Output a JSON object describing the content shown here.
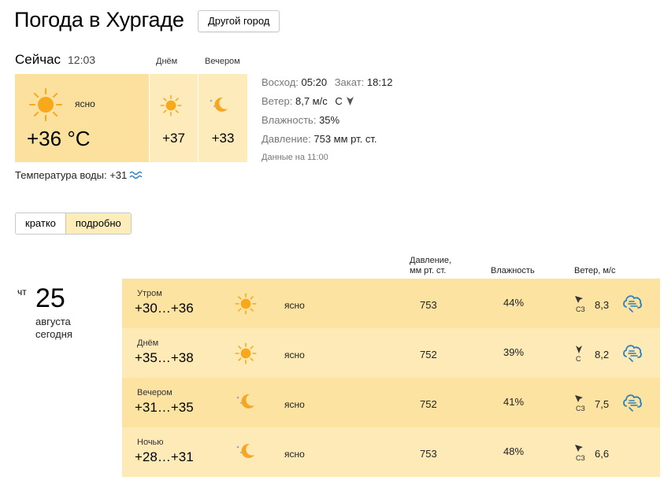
{
  "header": {
    "title": "Погода в Хургаде",
    "city_button": "Другой город"
  },
  "now": {
    "label": "Сейчас",
    "time": "12:03",
    "condition": "ясно",
    "temp": "+36 °C",
    "icon": "sun-icon"
  },
  "later": {
    "day_label": "Днём",
    "day_temp": "+37",
    "day_icon": "sun-icon",
    "evening_label": "Вечером",
    "evening_temp": "+33",
    "evening_icon": "moon-icon"
  },
  "details": {
    "sunrise_label": "Восход:",
    "sunrise": "05:20",
    "sunset_label": "Закат:",
    "sunset": "18:12",
    "wind_label": "Ветер:",
    "wind": "8,7 м/с",
    "wind_dir": "С",
    "humidity_label": "Влажность:",
    "humidity": "35%",
    "pressure_label": "Давление:",
    "pressure": "753 мм рт. ст.",
    "data_time": "Данные на 11:00"
  },
  "water": {
    "label": "Температура воды:",
    "value": "+31",
    "icon": "water-wave-icon"
  },
  "tabs": [
    {
      "label": "кратко",
      "active": false
    },
    {
      "label": "подробно",
      "active": true
    }
  ],
  "columns": {
    "pressure_line1": "Давление,",
    "pressure_line2": "мм рт. ст.",
    "humidity": "Влажность",
    "wind": "Ветер, м/с"
  },
  "forecast_day": {
    "dow": "чт",
    "day": "25",
    "month": "августа",
    "relative": "сегодня"
  },
  "periods": [
    {
      "name": "Утром",
      "range": "+30…+36",
      "icon": "sun-icon",
      "condition": "ясно",
      "pressure": "753",
      "humidity": "44%",
      "wind_dir": "СЗ",
      "wind_arrow": "arrow-northwest-icon",
      "wind": "8,3",
      "gust_icon": "strong-wind-icon"
    },
    {
      "name": "Днём",
      "range": "+35…+38",
      "icon": "sun-icon",
      "condition": "ясно",
      "pressure": "752",
      "humidity": "39%",
      "wind_dir": "С",
      "wind_arrow": "arrow-north-icon",
      "wind": "8,2",
      "gust_icon": "strong-wind-icon"
    },
    {
      "name": "Вечером",
      "range": "+31…+35",
      "icon": "moon-icon",
      "condition": "ясно",
      "pressure": "752",
      "humidity": "41%",
      "wind_dir": "СЗ",
      "wind_arrow": "arrow-northwest-icon",
      "wind": "7,5",
      "gust_icon": "strong-wind-icon"
    },
    {
      "name": "Ночью",
      "range": "+28…+31",
      "icon": "moon-icon",
      "condition": "ясно",
      "pressure": "753",
      "humidity": "48%",
      "wind_dir": "СЗ",
      "wind_arrow": "arrow-northwest-icon",
      "wind": "6,6",
      "gust_icon": ""
    }
  ],
  "colors": {
    "now_card": "#fbe19d",
    "later_card": "#fdebbb",
    "row_dark": "#fce3a2",
    "row_light": "#fdeab7",
    "sun": "#f7a81b",
    "moon": "#f5a623",
    "wave": "#2f84c7",
    "gust": "#2e7fb5"
  }
}
